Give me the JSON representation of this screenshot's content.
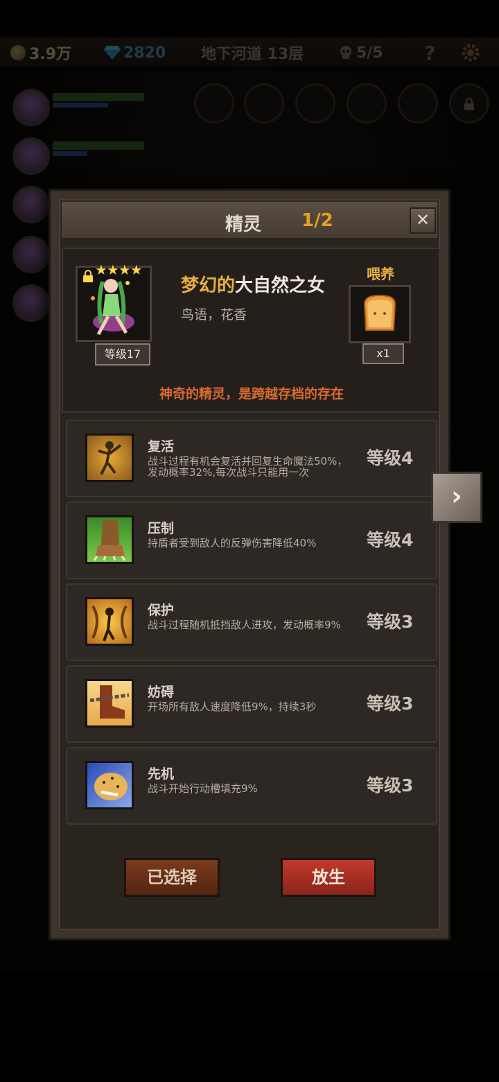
{
  "topbar": {
    "gold": "3.9万",
    "gems": "2820",
    "location": "地下河道 13层",
    "skulls": "5/5",
    "help": "?"
  },
  "dialog": {
    "title": "精灵",
    "count": "1/2",
    "close": "✕",
    "spirit": {
      "stars": "★★★★",
      "level": "等级17",
      "name_prefix": "梦幻的",
      "name_main": "大自然之女",
      "description": "鸟语，花香"
    },
    "feed": {
      "label": "喂养",
      "quantity": "x1"
    },
    "tagline": "神奇的精灵，是跨越存档的存在",
    "skills": [
      {
        "name": "复活",
        "desc": "战斗过程有机会复活并回复生命魔法50%，发动概率32%,每次战斗只能用一次",
        "level": "等级4",
        "icon": "revive-icon"
      },
      {
        "name": "压制",
        "desc": "持盾者受到敌人的反弹伤害降低40%",
        "level": "等级4",
        "icon": "beast-claw-icon"
      },
      {
        "name": "保护",
        "desc": "战斗过程随机抵挡敌人进攻，发动概率9%",
        "level": "等级3",
        "icon": "guardian-icon"
      },
      {
        "name": "妨碍",
        "desc": "开场所有敌人速度降低9%，持续3秒",
        "level": "等级3",
        "icon": "chained-boot-icon"
      },
      {
        "name": "先机",
        "desc": "战斗开始行动槽填充9%",
        "level": "等级3",
        "icon": "leopard-icon"
      }
    ],
    "buttons": {
      "selected": "已选择",
      "release": "放生"
    }
  },
  "side": {
    "next": "›"
  }
}
